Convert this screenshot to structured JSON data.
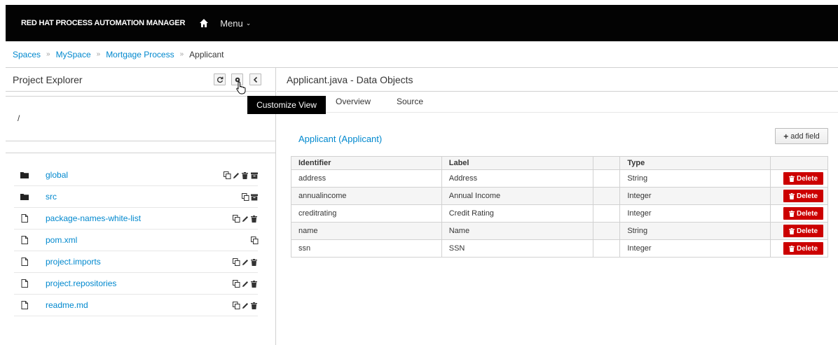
{
  "app": {
    "brand": "RED HAT PROCESS AUTOMATION MANAGER",
    "menu_label": "Menu"
  },
  "breadcrumb": {
    "items": [
      "Spaces",
      "MySpace",
      "Mortgage Process"
    ],
    "separator": "»",
    "current": "Applicant"
  },
  "left_panel": {
    "title": "Project Explorer",
    "path": "/",
    "tooltip": "Customize View",
    "files": [
      {
        "name": "global",
        "icon": "folder-icon",
        "actions": [
          "copy-icon",
          "edit-icon",
          "delete-icon",
          "archive-icon"
        ]
      },
      {
        "name": "src",
        "icon": "folder-icon",
        "actions": [
          "copy-icon",
          "archive-icon"
        ]
      },
      {
        "name": "package-names-white-list",
        "icon": "file-icon",
        "actions": [
          "copy-icon",
          "edit-icon",
          "delete-icon"
        ]
      },
      {
        "name": "pom.xml",
        "icon": "file-icon",
        "actions": [
          "copy-icon"
        ]
      },
      {
        "name": "project.imports",
        "icon": "file-icon",
        "actions": [
          "copy-icon",
          "edit-icon",
          "delete-icon"
        ]
      },
      {
        "name": "project.repositories",
        "icon": "file-icon",
        "actions": [
          "copy-icon",
          "edit-icon",
          "delete-icon"
        ]
      },
      {
        "name": "readme.md",
        "icon": "file-icon",
        "actions": [
          "copy-icon",
          "edit-icon",
          "delete-icon"
        ]
      }
    ]
  },
  "editor": {
    "title": "Applicant.java - Data Objects",
    "tabs": [
      "Overview",
      "Source"
    ],
    "object_title": "Applicant (Applicant)",
    "add_field_label": "add field",
    "columns": [
      "Identifier",
      "Label",
      "",
      "Type",
      ""
    ],
    "delete_label": "Delete",
    "rows": [
      {
        "identifier": "address",
        "label": "Address",
        "type": "String"
      },
      {
        "identifier": "annualincome",
        "label": "Annual Income",
        "type": "Integer"
      },
      {
        "identifier": "creditrating",
        "label": "Credit Rating",
        "type": "Integer"
      },
      {
        "identifier": "name",
        "label": "Name",
        "type": "String"
      },
      {
        "identifier": "ssn",
        "label": "SSN",
        "type": "Integer"
      }
    ]
  },
  "colors": {
    "topbar": "#030303",
    "link": "#0088ce",
    "danger": "#cc0000"
  }
}
